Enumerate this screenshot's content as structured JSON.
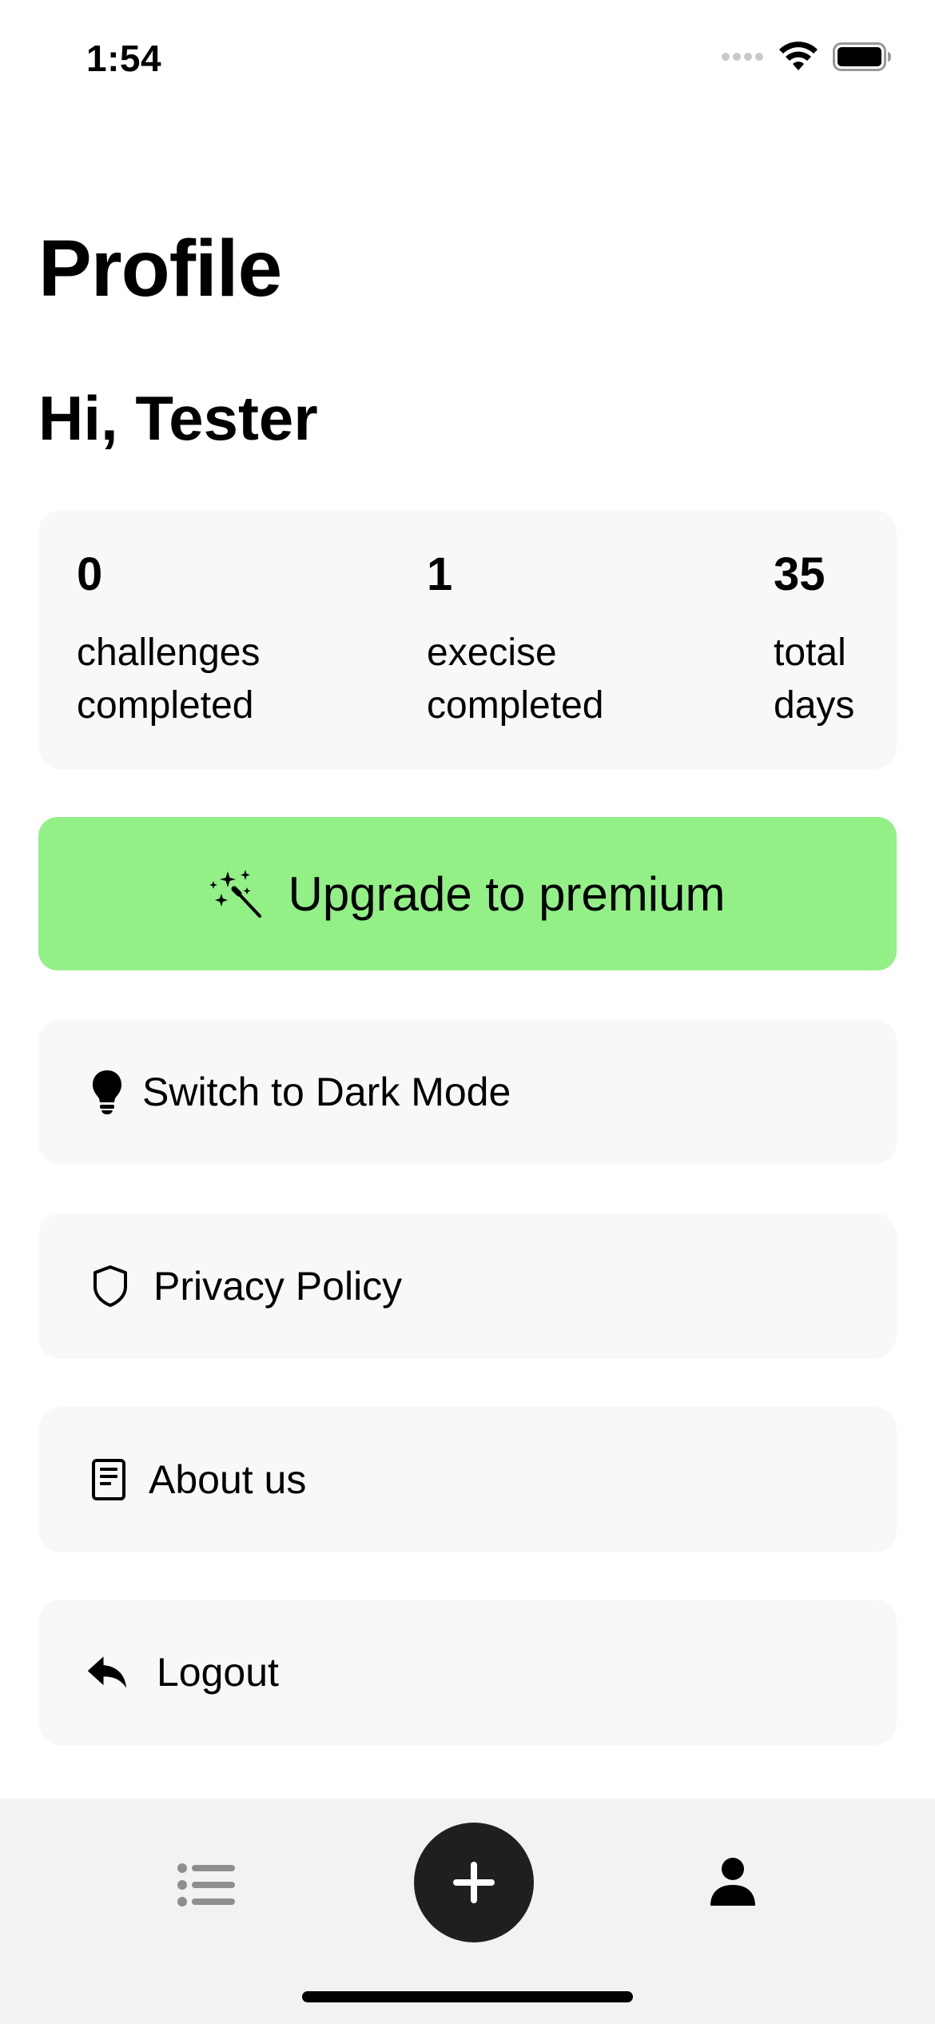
{
  "status_bar": {
    "time": "1:54"
  },
  "header": {
    "title": "Profile",
    "greeting": "Hi, Tester"
  },
  "stats": [
    {
      "value": "0",
      "label": "challenges completed"
    },
    {
      "value": "1",
      "label": "execise completed"
    },
    {
      "value": "35",
      "label": "total days"
    }
  ],
  "premium": {
    "label": "Upgrade to premium",
    "icon": "magic-wand-icon",
    "color": "#92f087"
  },
  "menu": {
    "dark_mode": {
      "label": "Switch to Dark Mode",
      "icon": "lightbulb-icon"
    },
    "privacy": {
      "label": "Privacy Policy",
      "icon": "shield-icon"
    },
    "about": {
      "label": "About us",
      "icon": "document-icon"
    },
    "logout": {
      "label": "Logout",
      "icon": "reply-arrow-icon"
    }
  },
  "tab_bar": {
    "items": [
      {
        "icon": "list-icon",
        "active": false
      },
      {
        "icon": "plus-icon",
        "active": false
      },
      {
        "icon": "person-icon",
        "active": true
      }
    ]
  }
}
